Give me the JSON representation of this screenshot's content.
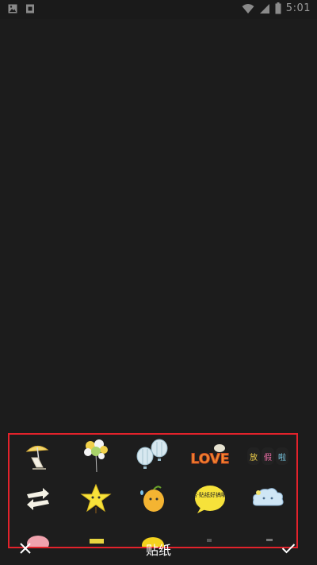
{
  "status_bar": {
    "time": "5:01",
    "icons": [
      "image-notification-icon",
      "sim-icon",
      "wifi-icon",
      "signal-icon",
      "battery-icon"
    ]
  },
  "editor": {
    "title": "贴纸",
    "close_icon": "close-icon",
    "confirm_icon": "check-icon"
  },
  "stickers": {
    "rows": [
      [
        "beach-chair-umbrella-sticker",
        "balloon-bunch-sticker",
        "hot-air-balloons-sticker",
        "love-text-sticker",
        "vacation-text-sticker"
      ],
      [
        "arrows-sticker",
        "star-sticker",
        "lemon-character-sticker",
        "speech-bubble-sticker",
        "cloud-sticker"
      ],
      [
        "pink-partial-sticker",
        "yellow-partial-sticker",
        "yellow-round-partial-sticker",
        "dark-partial-sticker",
        "gray-partial-sticker"
      ]
    ],
    "love_text": "LOVE",
    "vacation_text": [
      "放",
      "假",
      "啦"
    ],
    "bubble_text": "哈·贴纸好搞嘛·"
  },
  "colors": {
    "background": "#1c1c1c",
    "panel_border": "#e2222b",
    "icon": "#ffffff"
  }
}
